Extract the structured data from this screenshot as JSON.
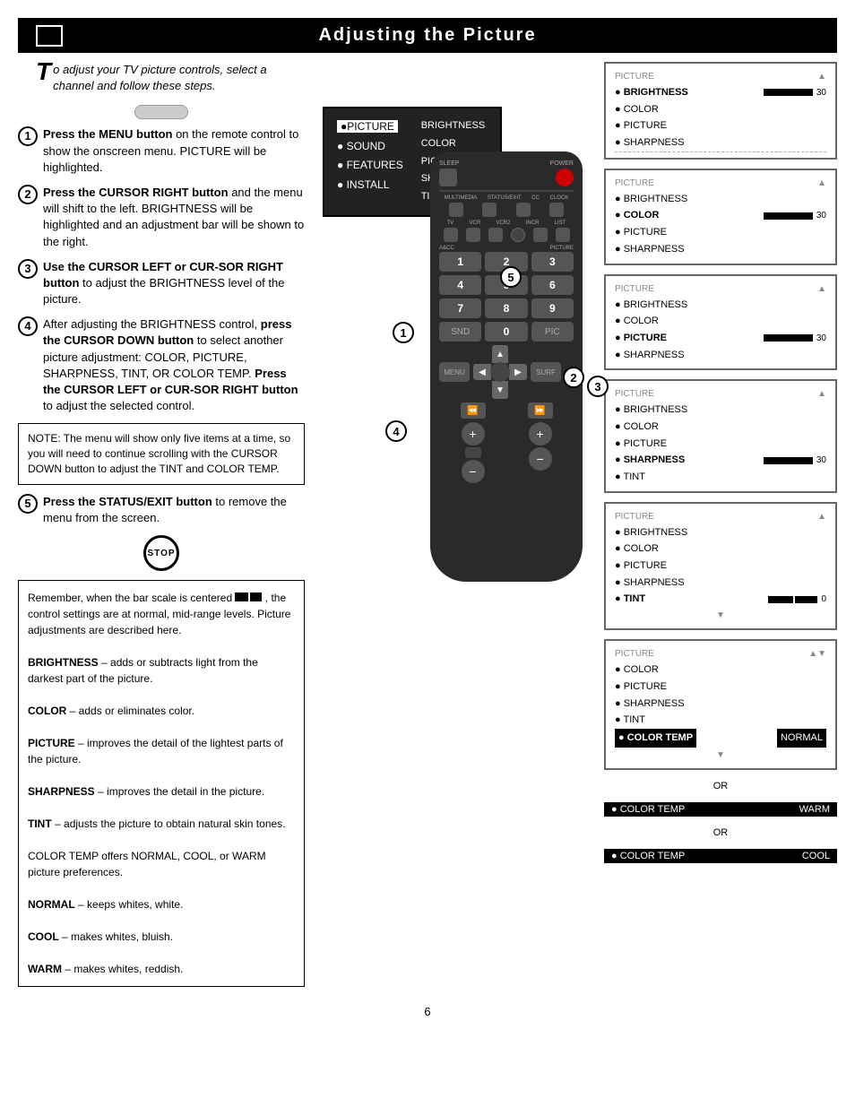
{
  "header": {
    "title": "Adjusting the Picture",
    "box_label": ""
  },
  "intro": {
    "text": "o adjust your TV picture controls, select a channel and follow these steps."
  },
  "steps": [
    {
      "num": "1",
      "text": "Press the MENU button on the remote control to show the onscreen menu. PICTURE will be highlighted."
    },
    {
      "num": "2",
      "text": "Press the CURSOR RIGHT button and the menu will shift to the left. BRIGHTNESS will be highlighted and an adjustment bar will be shown to the right."
    },
    {
      "num": "3",
      "text": "Use the CURSOR LEFT or CURSOR RIGHT button to adjust the BRIGHTNESS level of the picture."
    },
    {
      "num": "4",
      "text": "After adjusting the BRIGHTNESS control, press the CURSOR DOWN button to select another picture adjustment: COLOR, PICTURE, SHARPNESS, TINT, OR COLOR TEMP. Press the CURSOR LEFT or CURSOR RIGHT button to adjust the selected control."
    },
    {
      "num": "5",
      "text": "Press the STATUS/EXIT button to remove the menu from the screen."
    }
  ],
  "note": {
    "text": "NOTE: The menu will show only five items at a time, so you will need to continue scrolling with the CURSOR DOWN button to adjust the TINT and COLOR TEMP."
  },
  "stop_label": "STOP",
  "info_box": {
    "intro": "Remember, when the bar scale is centered",
    "middle": ", the control settings are at normal, mid-range levels. Picture adjustments are described here.",
    "items": [
      {
        "term": "BRIGHTNESS",
        "desc": "– adds or subtracts light from the darkest part of the picture."
      },
      {
        "term": "COLOR",
        "desc": "– adds or eliminates color."
      },
      {
        "term": "PICTURE",
        "desc": "– improves the detail of the lightest parts of the picture."
      },
      {
        "term": "SHARPNESS",
        "desc": "– improves the detail in the picture."
      },
      {
        "term": "TINT",
        "desc": "– adjusts the picture to obtain natural skin tones."
      },
      {
        "term": "COLOR TEMP",
        "desc": "offers NORMAL, COOL, or WARM picture preferences."
      },
      {
        "term": "NORMAL",
        "desc": "– keeps whites, white."
      },
      {
        "term": "COOL",
        "desc": "– makes whites, bluish."
      },
      {
        "term": "WARM",
        "desc": "– makes whites, reddish."
      }
    ]
  },
  "osd_menu": {
    "highlighted": "●PICTURE",
    "items_left": [
      "● SOUND",
      "● FEATURES",
      "● INSTALL"
    ],
    "items_right": [
      "BRIGHTNESS",
      "COLOR",
      "PICTURE",
      "SHARPNESS",
      "TINT"
    ]
  },
  "screen_menus": [
    {
      "title": "PICTURE",
      "arrow": "▲",
      "items": [
        {
          "label": "● BRIGHTNESS",
          "active": true,
          "bar": 50,
          "value": "30"
        },
        {
          "label": "● COLOR",
          "active": false
        },
        {
          "label": "● PICTURE",
          "active": false
        },
        {
          "label": "● SHARPNESS",
          "active": false
        }
      ]
    },
    {
      "title": "PICTURE",
      "arrow": "▲",
      "items": [
        {
          "label": "● BRIGHTNESS",
          "active": false
        },
        {
          "label": "● COLOR",
          "active": true,
          "bar": 50,
          "value": "30"
        },
        {
          "label": "● PICTURE",
          "active": false
        },
        {
          "label": "● SHARPNESS",
          "active": false
        }
      ]
    },
    {
      "title": "PICTURE",
      "arrow": "▲",
      "items": [
        {
          "label": "● BRIGHTNESS",
          "active": false
        },
        {
          "label": "● COLOR",
          "active": false
        },
        {
          "label": "● PICTURE",
          "active": true,
          "bar": 50,
          "value": "30"
        },
        {
          "label": "● SHARPNESS",
          "active": false
        }
      ]
    },
    {
      "title": "PICTURE",
      "arrow": "▲",
      "items": [
        {
          "label": "● BRIGHTNESS",
          "active": false
        },
        {
          "label": "● COLOR",
          "active": false
        },
        {
          "label": "● PICTURE",
          "active": false
        },
        {
          "label": "● SHARPNESS",
          "active": true,
          "bar": 50,
          "value": "30"
        },
        {
          "label": "● TINT",
          "active": false
        }
      ]
    },
    {
      "title": "PICTURE",
      "arrow": "▲",
      "items": [
        {
          "label": "● BRIGHTNESS",
          "active": false
        },
        {
          "label": "● COLOR",
          "active": false
        },
        {
          "label": "● PICTURE",
          "active": false
        },
        {
          "label": "● SHARPNESS",
          "active": false
        },
        {
          "label": "● TINT",
          "active": true,
          "bar": 50,
          "value": "0"
        }
      ],
      "down_arrow": "▼"
    },
    {
      "title": "PICTURE",
      "arrow": "▲▼",
      "items": [
        {
          "label": "● COLOR",
          "active": false
        },
        {
          "label": "● PICTURE",
          "active": false
        },
        {
          "label": "● SHARPNESS",
          "active": false
        },
        {
          "label": "● TINT",
          "active": false
        },
        {
          "label": "● COLOR TEMP",
          "active": true,
          "value": "NORMAL"
        }
      ],
      "down_arrow": "▼"
    }
  ],
  "color_temp_rows": [
    {
      "label": "● COLOR TEMP",
      "value": "WARM"
    },
    {
      "label": "● COLOR TEMP",
      "value": "COOL"
    }
  ],
  "or_text": "OR",
  "page_number": "6"
}
